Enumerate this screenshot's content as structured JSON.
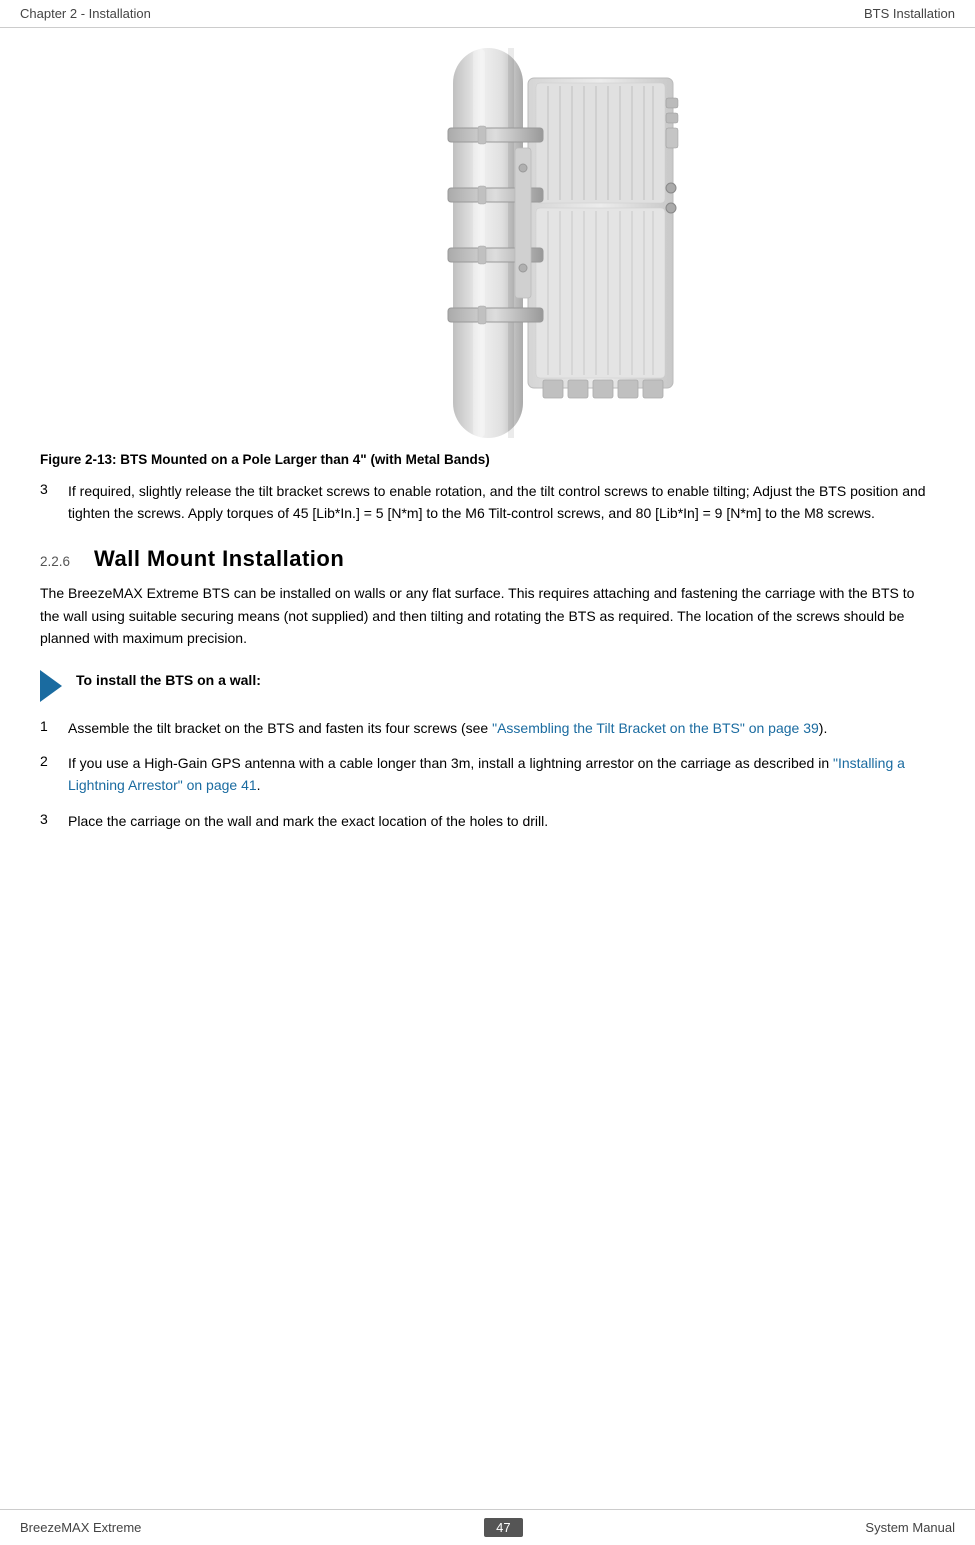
{
  "header": {
    "left": "Chapter 2 - Installation",
    "right": "BTS Installation"
  },
  "figure": {
    "caption": "Figure 2-13: BTS Mounted on a Pole Larger than 4\" (with Metal Bands)"
  },
  "steps_before_section": [
    {
      "number": "3",
      "text": "If required, slightly release the tilt bracket screws to enable rotation, and the tilt control screws to enable tilting; Adjust the BTS position and tighten the screws. Apply torques of 45 [Lib*In.] = 5 [N*m] to the M6 Tilt-control screws, and 80 [Lib*In] = 9 [N*m] to the M8 screws."
    }
  ],
  "section": {
    "number": "2.2.6",
    "title": "Wall Mount Installation"
  },
  "body_paragraph": "The BreezeMAX Extreme BTS can be installed on walls or any flat surface. This requires attaching and fastening the carriage with the BTS to the wall using suitable securing means (not supplied) and then tilting and rotating the BTS as required. The location of the screws should be planned with maximum precision.",
  "note_block": {
    "arrow_label": "arrow-icon",
    "text": "To install the BTS on a wall:"
  },
  "steps_after_note": [
    {
      "number": "1",
      "text_plain": "Assemble the tilt bracket on the BTS and fasten its four screws (see ",
      "link": "\"Assembling the Tilt Bracket on the BTS\" on page 39",
      "text_after": ")."
    },
    {
      "number": "2",
      "text_plain": "If you use a High-Gain GPS antenna with a cable longer than 3m, install a lightning arrestor on the carriage as described in ",
      "link": "\"Installing a Lightning Arrestor\" on page 41",
      "text_after": "."
    },
    {
      "number": "3",
      "text_plain": "Place the carriage on the wall and mark the exact location of the holes to drill.",
      "link": "",
      "text_after": ""
    }
  ],
  "footer": {
    "left": "BreezeMAX Extreme",
    "page": "47",
    "right": "System Manual"
  }
}
